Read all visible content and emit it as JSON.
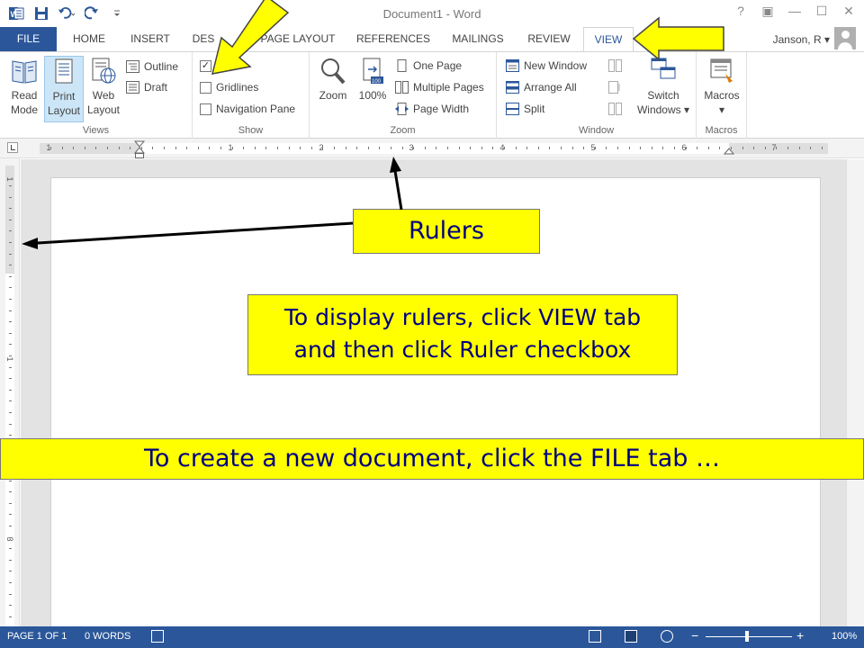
{
  "window": {
    "title": "Document1 - Word",
    "controls": [
      "?",
      "▣",
      "—",
      "☐",
      "✕"
    ]
  },
  "qat": {
    "icons": [
      "word-icon",
      "save-icon",
      "undo-icon",
      "redo-icon",
      "customize-icon"
    ]
  },
  "tabs": {
    "file": "FILE",
    "home": "HOME",
    "insert": "INSERT",
    "design": "DES",
    "page_layout": "PAGE LAYOUT",
    "references": "REFERENCES",
    "mailings": "MAILINGS",
    "review": "REVIEW",
    "view": "VIEW"
  },
  "account": {
    "name": "Janson, R ▾"
  },
  "ribbon": {
    "views": {
      "label": "Views",
      "read_mode": "Read Mode",
      "print_layout": "Print Layout",
      "web_layout": "Web Layout",
      "outline": "Outline",
      "draft": "Draft"
    },
    "show": {
      "label": "Show",
      "ruler": "Ruler",
      "ruler_checked": true,
      "gridlines": "Gridlines",
      "navigation_pane": "Navigation Pane"
    },
    "zoom": {
      "label": "Zoom",
      "zoom": "Zoom",
      "hundred": "100%",
      "one_page": "One Page",
      "multiple_pages": "Multiple Pages",
      "page_width": "Page Width"
    },
    "window": {
      "label": "Window",
      "new_window": "New Window",
      "arrange_all": "Arrange All",
      "split": "Split",
      "switch_windows": "Switch Windows ▾"
    },
    "macros": {
      "label": "Macros",
      "macros": "Macros",
      "dropdown": "▾"
    }
  },
  "ruler": {
    "h_numbers": [
      "1",
      "1",
      "2",
      "3",
      "4",
      "5",
      "6",
      "7"
    ],
    "v_numbers": [
      "1",
      "1",
      "2",
      "3"
    ]
  },
  "callouts": {
    "rulers": "Rulers",
    "display_line1": "To display rulers, click VIEW tab",
    "display_line2": "and then click Ruler checkbox",
    "new_doc": "To create a new document, click the FILE tab …"
  },
  "status": {
    "page": "PAGE 1 OF 1",
    "words": "0 WORDS",
    "zoom": "100%"
  },
  "colors": {
    "accent": "#2b579a",
    "callout": "#ffff00",
    "callout_text": "#000080"
  }
}
